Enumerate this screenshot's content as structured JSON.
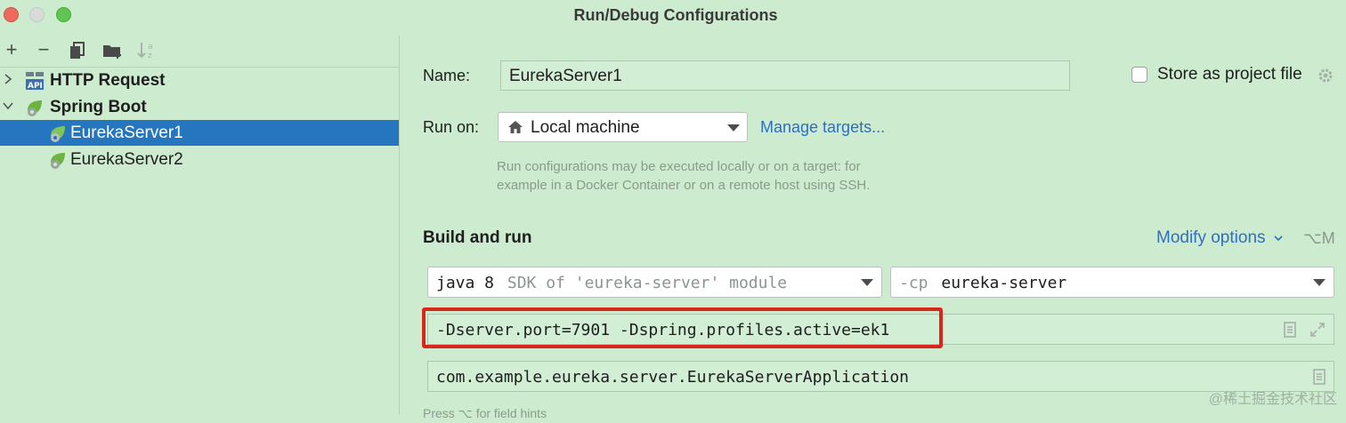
{
  "window": {
    "title": "Run/Debug Configurations"
  },
  "tree": {
    "items": [
      {
        "label": "HTTP Request",
        "expanded": false,
        "bold": true,
        "icon": "api-icon"
      },
      {
        "label": "Spring Boot",
        "expanded": true,
        "bold": true,
        "icon": "spring-boot-icon"
      },
      {
        "label": "EurekaServer1",
        "selected": true,
        "icon": "spring-boot-config-icon"
      },
      {
        "label": "EurekaServer2",
        "selected": false,
        "icon": "spring-boot-config-icon"
      }
    ]
  },
  "form": {
    "name_label": "Name:",
    "name_value": "EurekaServer1",
    "store_label": "Store as project file",
    "store_checked": false,
    "run_on_label": "Run on:",
    "run_on_value": "Local machine",
    "manage_targets": "Manage targets...",
    "hint_line1": "Run configurations may be executed locally or on a target: for",
    "hint_line2": "example in a Docker Container or on a remote host using SSH.",
    "section_title": "Build and run",
    "modify_options": "Modify options",
    "modify_shortcut": "⌥M",
    "jdk_name": "java 8",
    "jdk_desc": "SDK of 'eureka-server' module",
    "cp_prefix": "-cp",
    "cp_value": "eureka-server",
    "vm_options": "-Dserver.port=7901 -Dspring.profiles.active=ek1",
    "main_class": "com.example.eureka.server.EurekaServerApplication",
    "field_hint": "Press ⌥ for field hints"
  },
  "watermark": "@稀土掘金技术社区",
  "colors": {
    "accent": "#2675bf",
    "link": "#2f6ec2",
    "highlight_box": "#d9261c",
    "background": "#cdeccf"
  }
}
